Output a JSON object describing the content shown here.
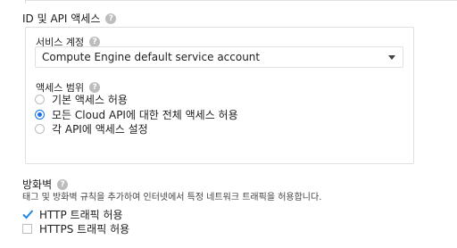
{
  "access": {
    "title": "ID 및 API 액세스",
    "service_account": {
      "label": "서비스 계정",
      "selected": "Compute Engine default service account"
    },
    "scope": {
      "label": "액세스 범위",
      "options": [
        {
          "label": "기본 액세스 허용",
          "selected": false
        },
        {
          "label": "모든 Cloud API에 대한 전체 액세스 허용",
          "selected": true
        },
        {
          "label": "각 API에 액세스 설정",
          "selected": false
        }
      ]
    }
  },
  "firewall": {
    "title": "방화벽",
    "description": "태그 및 방화벽 규칙을 추가하여 인터넷에서 특정 네트워크 트래픽을 허용합니다.",
    "options": [
      {
        "label": "HTTP 트래픽 허용",
        "checked": true
      },
      {
        "label": "HTTPS 트래픽 허용",
        "checked": false
      }
    ]
  },
  "icons": {
    "help": "?"
  },
  "colors": {
    "accent": "#1a73e8",
    "check": "#1e88e5"
  }
}
